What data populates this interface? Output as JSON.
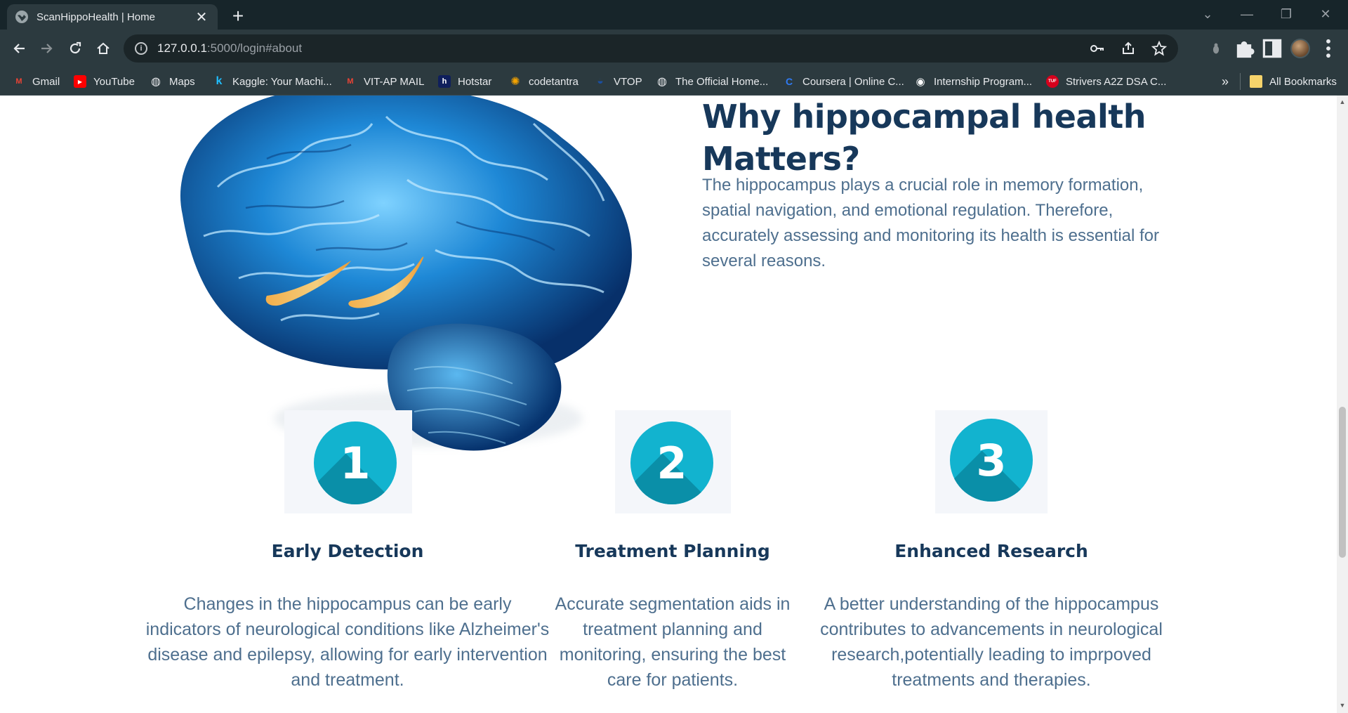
{
  "browser": {
    "tab_title": "ScanHippoHealth | Home",
    "tab_close": "✕",
    "new_tab": "+",
    "url_host": "127.0.0.1",
    "url_path": ":5000/login#about",
    "info_glyph": "i"
  },
  "bookmarks": [
    {
      "label": "Gmail",
      "icon": "gmail-icon",
      "color": "#ea4335",
      "glyph": "M"
    },
    {
      "label": "YouTube",
      "icon": "youtube-icon",
      "color": "#ff0000",
      "glyph": "▶"
    },
    {
      "label": "Maps",
      "icon": "globe-icon",
      "color": "#5f6368",
      "glyph": "◍"
    },
    {
      "label": "Kaggle: Your Machi...",
      "icon": "kaggle-icon",
      "color": "#20beff",
      "glyph": "k"
    },
    {
      "label": "VIT-AP MAIL",
      "icon": "gmail-icon",
      "color": "#ea4335",
      "glyph": "M"
    },
    {
      "label": "Hotstar",
      "icon": "hotstar-icon",
      "color": "#0f1f5c",
      "glyph": "h"
    },
    {
      "label": "codetantra",
      "icon": "codetantra-icon",
      "color": "#f4a300",
      "glyph": "✺"
    },
    {
      "label": "VTOP",
      "icon": "vtop-icon",
      "color": "#1a4fa0",
      "glyph": "◒"
    },
    {
      "label": "The Official Home...",
      "icon": "globe-icon",
      "color": "#5f6368",
      "glyph": "◍"
    },
    {
      "label": "Coursera | Online C...",
      "icon": "coursera-icon",
      "color": "#0056d2",
      "glyph": "C"
    },
    {
      "label": "Internship Program...",
      "icon": "internship-icon",
      "color": "#ffffff",
      "glyph": "◉"
    },
    {
      "label": "Strivers A2Z DSA C...",
      "icon": "tuf-icon",
      "color": "#d6001c",
      "glyph": "TUF"
    }
  ],
  "bookmarks_overflow": "»",
  "all_bookmarks": "All Bookmarks",
  "about": {
    "title": "Why hippocampal health Matters?",
    "text": "The hippocampus plays a crucial role in memory formation, spatial navigation, and emotional regulation. Therefore, accurately assessing and monitoring its health is essential for several reasons."
  },
  "features": [
    {
      "number": "1",
      "title": "Early Detection",
      "text": "Changes in the hippocampus can be early indicators of neurological conditions like Alzheimer's disease and epilepsy, allowing for early intervention and treatment."
    },
    {
      "number": "2",
      "title": "Treatment Planning",
      "text": "Accurate segmentation aids in treatment planning and monitoring, ensuring the best care for patients."
    },
    {
      "number": "3",
      "title": "Enhanced Research",
      "text": "A better understanding of the hippocampus contributes to advancements in neurological research,potentially leading to imprpoved treatments and therapies."
    }
  ],
  "colors": {
    "heading": "#17385a",
    "body_text": "#4e6f8e",
    "accent_teal": "#12b3cf",
    "brain_blue": "#1e88d6",
    "hippocampus_highlight": "#f5a623"
  }
}
